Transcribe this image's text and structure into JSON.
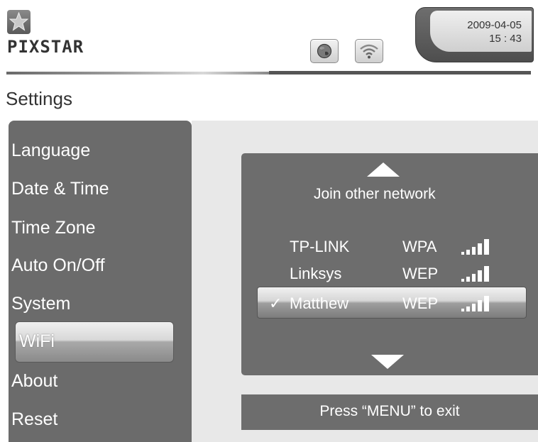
{
  "header": {
    "logo_text": "PIXSTAR",
    "date": "2009-04-05",
    "time": "15 : 43",
    "icons": [
      "star-icon",
      "globe-icon",
      "wifi-icon"
    ]
  },
  "page": {
    "title": "Settings"
  },
  "sidebar": {
    "items": [
      {
        "label": "Language"
      },
      {
        "label": "Date & Time"
      },
      {
        "label": "Time Zone"
      },
      {
        "label": "Auto On/Off"
      },
      {
        "label": "System"
      },
      {
        "label": "WiFi",
        "selected": true
      },
      {
        "label": "About"
      },
      {
        "label": "Reset"
      }
    ]
  },
  "networks": {
    "join_label": "Join  other network",
    "list": [
      {
        "name": "TP-LINK",
        "security": "WPA",
        "signal": 5,
        "connected": false
      },
      {
        "name": "Linksys",
        "security": "WEP",
        "signal": 5,
        "connected": false
      },
      {
        "name": "Matthew",
        "security": "WEP",
        "signal": 5,
        "connected": true
      }
    ],
    "check_mark": "✓"
  },
  "footer": {
    "exit_hint": "Press “MENU” to exit"
  },
  "colors": {
    "panel": "#6d6d6d",
    "sidebar": "#6b6b6b",
    "content_bg": "#e8e8e8"
  }
}
